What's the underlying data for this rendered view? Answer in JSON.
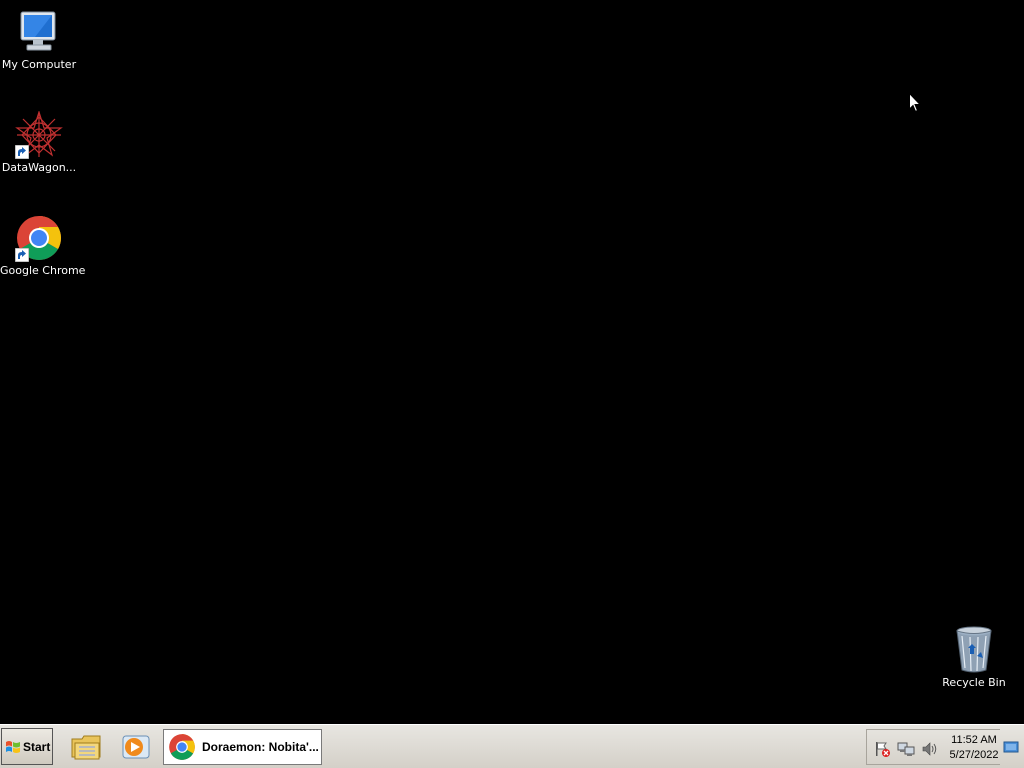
{
  "desktop": {
    "icons": [
      {
        "label": "My Computer",
        "icon": "my-computer-icon"
      },
      {
        "label": "DataWagon...",
        "icon": "datawagon-icon"
      },
      {
        "label": "Google Chrome",
        "icon": "chrome-icon"
      },
      {
        "label": "Recycle Bin",
        "icon": "recycle-bin-icon"
      }
    ]
  },
  "taskbar": {
    "start_label": "Start",
    "quick_launch": [
      {
        "icon": "file-explorer-icon"
      },
      {
        "icon": "media-player-icon"
      }
    ],
    "tasks": [
      {
        "label": "Doraemon: Nobita'...",
        "icon": "chrome-icon"
      }
    ],
    "tray": {
      "icons": [
        "action-center-flag-icon",
        "network-icon",
        "volume-icon"
      ],
      "time": "11:52 AM",
      "date": "5/27/2022"
    }
  },
  "colors": {
    "desktop_bg": "#000000",
    "taskbar_bg": "#d4d0c8",
    "chrome_red": "#db4437",
    "chrome_yellow": "#f4c20d",
    "chrome_green": "#0f9d58",
    "chrome_blue": "#4285f4"
  }
}
